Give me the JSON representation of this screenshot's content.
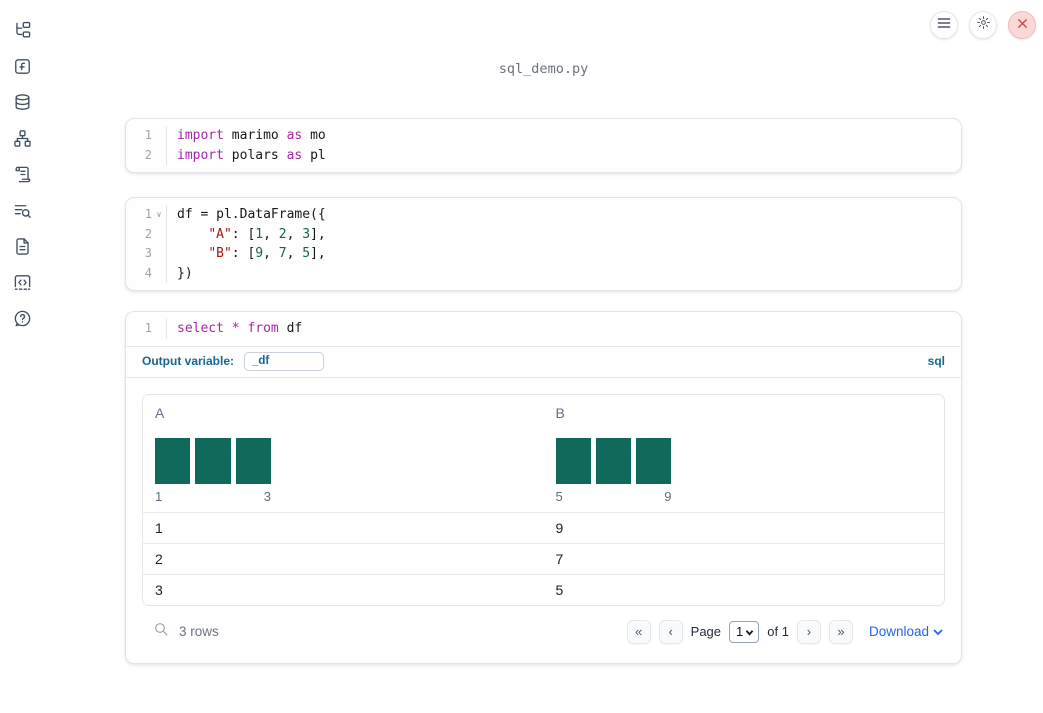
{
  "window": {
    "title": "sql_demo.py"
  },
  "topbar": {
    "icons": [
      "hamburger-menu-icon",
      "gear-icon",
      "close-x-icon"
    ]
  },
  "sidebar": {
    "items": [
      {
        "icon": "file-tree-icon"
      },
      {
        "icon": "function-square-icon"
      },
      {
        "icon": "database-icon"
      },
      {
        "icon": "dependency-graph-icon"
      },
      {
        "icon": "scroll-icon"
      },
      {
        "icon": "text-search-icon"
      },
      {
        "icon": "file-text-icon"
      },
      {
        "icon": "code-square-icon"
      },
      {
        "icon": "help-bubble-icon"
      }
    ]
  },
  "cells": [
    {
      "id": "imports",
      "lines": [
        {
          "n": "1",
          "tokens": [
            [
              "import",
              "kw"
            ],
            [
              " marimo ",
              "pl"
            ],
            [
              "as",
              "kw"
            ],
            [
              " mo",
              "pl"
            ]
          ]
        },
        {
          "n": "2",
          "tokens": [
            [
              "import",
              "kw"
            ],
            [
              " polars ",
              "pl"
            ],
            [
              "as",
              "kw"
            ],
            [
              " pl",
              "pl"
            ]
          ]
        }
      ]
    },
    {
      "id": "dataframe",
      "fold_marker": "∨",
      "lines": [
        {
          "n": "1",
          "tokens": [
            [
              "df = pl.DataFrame({",
              "pl"
            ]
          ]
        },
        {
          "n": "2",
          "tokens": [
            [
              "    ",
              "pl"
            ],
            [
              "\"A\"",
              "str"
            ],
            [
              ": [",
              "pl"
            ],
            [
              "1",
              "num"
            ],
            [
              ", ",
              "pl"
            ],
            [
              "2",
              "num"
            ],
            [
              ", ",
              "pl"
            ],
            [
              "3",
              "num"
            ],
            [
              "],",
              "pl"
            ]
          ]
        },
        {
          "n": "3",
          "tokens": [
            [
              "    ",
              "pl"
            ],
            [
              "\"B\"",
              "str"
            ],
            [
              ": [",
              "pl"
            ],
            [
              "9",
              "num"
            ],
            [
              ", ",
              "pl"
            ],
            [
              "7",
              "num"
            ],
            [
              ", ",
              "pl"
            ],
            [
              "5",
              "num"
            ],
            [
              "],",
              "pl"
            ]
          ]
        },
        {
          "n": "4",
          "tokens": [
            [
              "})",
              "pl"
            ]
          ]
        }
      ]
    },
    {
      "id": "sql",
      "lines": [
        {
          "n": "1",
          "tokens": [
            [
              "select",
              "kw"
            ],
            [
              " ",
              "pl"
            ],
            [
              "*",
              "kw"
            ],
            [
              " ",
              "pl"
            ],
            [
              "from",
              "kw"
            ],
            [
              " df",
              "pl"
            ]
          ]
        }
      ],
      "output_variable_label": "Output variable:",
      "output_variable_value": "_df",
      "language_badge": "sql"
    }
  ],
  "table": {
    "columns": [
      {
        "label": "A",
        "hist": {
          "bins": [
            1,
            1,
            1
          ],
          "min_label": "1",
          "max_label": "3"
        }
      },
      {
        "label": "B",
        "hist": {
          "bins": [
            1,
            1,
            1
          ],
          "min_label": "5",
          "max_label": "9"
        }
      }
    ],
    "rows": [
      [
        "1",
        "9"
      ],
      [
        "2",
        "7"
      ],
      [
        "3",
        "5"
      ]
    ],
    "footer": {
      "rows_label": "3 rows",
      "page_label": "Page",
      "page_value": "1",
      "page_total_label": "of 1",
      "first": "«",
      "prev": "‹",
      "next": "›",
      "last": "»",
      "download_label": "Download"
    }
  },
  "colors": {
    "histogram_bar": "#106a5b",
    "keyword": "#a428a8",
    "string": "#a31515",
    "number": "#116644",
    "sql_accent": "#17678f",
    "link_blue": "#2563eb",
    "close_button_bg": "#fbd8d8"
  }
}
